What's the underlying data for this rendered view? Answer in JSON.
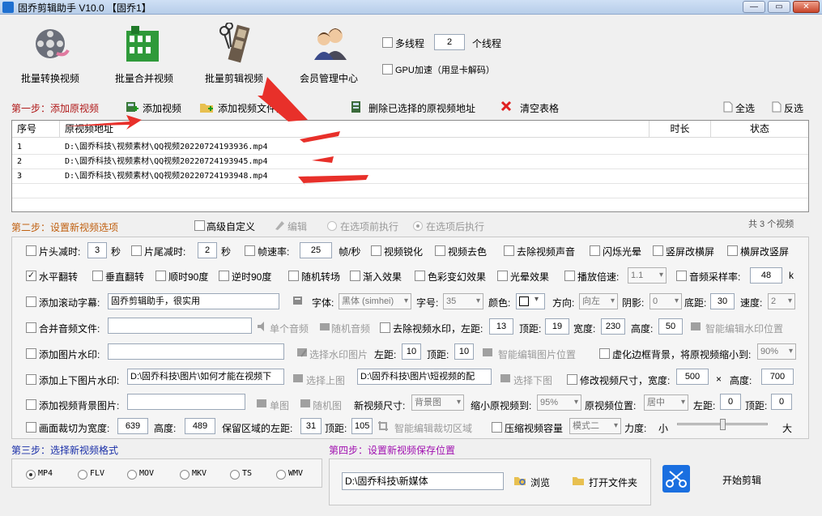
{
  "window": {
    "title": "固乔剪辑助手 V10.0  【固乔1】",
    "minimize": "—",
    "restore": "▭",
    "close": "✕"
  },
  "tools": {
    "convert": "批量转换视频",
    "merge": "批量合并视频",
    "edit": "批量剪辑视频",
    "member": "会员管理中心",
    "multithread_label": "多线程",
    "thread_count": "2",
    "thread_unit": "个线程",
    "gpu_label": "GPU加速（用显卡解码）"
  },
  "step1": {
    "label": "第一步：添加原视频",
    "add_video": "添加视频",
    "add_folder": "添加视频文件夹",
    "delete_selected": "删除已选择的原视频地址",
    "clear_table": "清空表格",
    "select_all": "全选",
    "invert": "反选"
  },
  "table": {
    "headers": [
      "序号",
      "原视频地址",
      "时长",
      "状态"
    ],
    "rows": [
      {
        "no": "1",
        "path": "D:\\固乔科技\\视频素材\\QQ视频20220724193936.mp4"
      },
      {
        "no": "2",
        "path": "D:\\固乔科技\\视频素材\\QQ视频20220724193945.mp4"
      },
      {
        "no": "3",
        "path": "D:\\固乔科技\\视频素材\\QQ视频20220724193948.mp4"
      }
    ]
  },
  "step2": {
    "label": "第二步：设置新视频选项",
    "advanced": "高级自定义",
    "edit": "编辑",
    "before": "在选项前执行",
    "after": "在选项后执行",
    "count": "共 3 个视频"
  },
  "row1": {
    "head_cut": "片头减时:",
    "head_val": "3",
    "sec1": "秒",
    "tail_cut": "片尾减时:",
    "tail_val": "2",
    "sec2": "秒",
    "fps": "帧速率:",
    "fps_val": "25",
    "fps_unit": "帧/秒",
    "sharpen": "视频锐化",
    "decolor": "视频去色",
    "mute": "去除视频声音",
    "flash": "闪烁光晕",
    "v2h": "竖屏改横屏",
    "h2v": "横屏改竖屏"
  },
  "row2": {
    "hflip": "水平翻转",
    "vflip": "垂直翻转",
    "cw90": "顺时90度",
    "ccw90": "逆时90度",
    "random_trans": "随机转场",
    "fade_in": "渐入效果",
    "color_shift": "色彩变幻效果",
    "glow": "光晕效果",
    "speed": "播放倍速:",
    "speed_val": "1.1",
    "sample_rate": "音频采样率:",
    "sample_val": "48",
    "sample_unit": "k"
  },
  "row3": {
    "scroll_sub": "添加滚动字幕:",
    "sub_text": "固乔剪辑助手，很实用",
    "font": "字体:",
    "font_val": "黑体 (simhei)",
    "size": "字号:",
    "size_val": "35",
    "color": "颜色:",
    "direction": "方向:",
    "direction_val": "向左",
    "shadow": "阴影:",
    "shadow_val": "0",
    "bottom": "底距:",
    "bottom_val": "30",
    "speed": "速度:",
    "speed_val": "2"
  },
  "row4": {
    "merge_audio": "合并音频文件:",
    "single_audio": "单个音频",
    "random_audio": "随机音频",
    "remove_wm": "去除视频水印，左距:",
    "left_val": "13",
    "top": "顶距:",
    "top_val": "19",
    "width": "宽度:",
    "width_val": "230",
    "height": "高度:",
    "height_val": "50",
    "smart_wm": "智能编辑水印位置"
  },
  "row5": {
    "img_wm": "添加图片水印:",
    "choose_img": "选择水印图片",
    "left": "左距:",
    "left_val": "10",
    "top": "顶距:",
    "top_val": "10",
    "smart_img": "智能编辑图片位置",
    "blur_bg": "虚化边框背景，将原视频缩小到:",
    "blur_val": "90%"
  },
  "row6": {
    "topbottom": "添加上下图片水印:",
    "top_path": "D:\\固乔科技\\图片\\如何才能在视频下",
    "choose_top": "选择上图",
    "bottom_path": "D:\\固乔科技\\图片\\短视频的配",
    "choose_bottom": "选择下图",
    "resize": "修改视频尺寸，宽度:",
    "w_val": "500",
    "times": "×",
    "height": "高度:",
    "h_val": "700"
  },
  "row7": {
    "bg_img": "添加视频背景图片:",
    "single": "单图",
    "random": "随机图",
    "new_size": "新视频尺寸:",
    "new_size_val": "背景图",
    "shrink": "缩小原视频到:",
    "shrink_val": "95%",
    "pos": "原视频位置:",
    "pos_val": "居中",
    "left": "左距:",
    "left_val": "0",
    "top": "顶距:",
    "top_val": "0"
  },
  "row8": {
    "crop": "画面裁切为宽度:",
    "crop_w": "639",
    "height": "高度:",
    "crop_h": "489",
    "keep_left": "保留区域的左距:",
    "keep_left_val": "31",
    "top": "顶距:",
    "top_val": "105",
    "smart_crop": "智能编辑裁切区域",
    "compress": "压缩视频容量",
    "mode_val": "模式二",
    "strength": "力度:",
    "small": "小",
    "big": "大"
  },
  "step3": {
    "label": "第三步：选择新视频格式",
    "formats": [
      "MP4",
      "FLV",
      "MOV",
      "MKV",
      "TS",
      "WMV"
    ]
  },
  "step4": {
    "label": "第四步：设置新视频保存位置",
    "path": "D:\\固乔科技\\新媒体",
    "browse": "浏览",
    "open_folder": "打开文件夹",
    "start": "开始剪辑"
  },
  "colors": {
    "step_red": "#b01818",
    "step_orange": "#c06010",
    "step_blue": "#1a2fa8",
    "step_purple": "#a010b0",
    "arrow_red": "#e8302a"
  }
}
